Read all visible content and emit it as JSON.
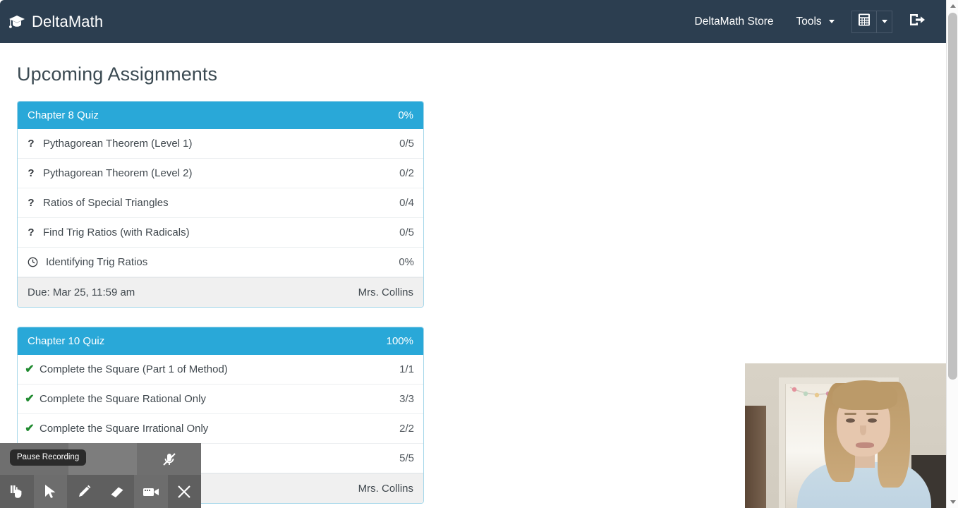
{
  "navbar": {
    "brand": "DeltaMath",
    "brand_icon": "graduation-cap-icon",
    "store_link": "DeltaMath Store",
    "tools_link": "Tools",
    "calculator_icon": "calculator-icon",
    "calculator_caret_icon": "chevron-down-icon",
    "logout_icon": "sign-out-icon",
    "background_color": "#2c3e50"
  },
  "page": {
    "title": "Upcoming Assignments",
    "accent_color": "#29a8d8",
    "card_border_color": "#a8d8ea",
    "check_color": "#1f8a2f"
  },
  "assignments": [
    {
      "title": "Chapter 8 Quiz",
      "percent": "0%",
      "rows": [
        {
          "icon": "question-mark-icon",
          "label": "Pythagorean Theorem (Level 1)",
          "score": "0/5"
        },
        {
          "icon": "question-mark-icon",
          "label": "Pythagorean Theorem (Level 2)",
          "score": "0/2"
        },
        {
          "icon": "question-mark-icon",
          "label": "Ratios of Special Triangles",
          "score": "0/4"
        },
        {
          "icon": "question-mark-icon",
          "label": "Find Trig Ratios (with Radicals)",
          "score": "0/5"
        },
        {
          "icon": "clock-icon",
          "label": "Identifying Trig Ratios",
          "score": "0%"
        }
      ],
      "due": "Due: Mar 25, 11:59 am",
      "teacher": "Mrs. Collins"
    },
    {
      "title": "Chapter 10 Quiz",
      "percent": "100%",
      "rows": [
        {
          "icon": "check-icon",
          "label": "Complete the Square (Part 1 of Method)",
          "score": "1/1"
        },
        {
          "icon": "check-icon",
          "label": "Complete the Square Rational Only",
          "score": "3/3"
        },
        {
          "icon": "check-icon",
          "label": "Complete the Square Irrational Only",
          "score": "2/2"
        },
        {
          "icon": "check-icon",
          "label": "",
          "score": "5/5"
        }
      ],
      "due": "",
      "teacher": "Mrs. Collins"
    }
  ],
  "recording_toolbar": {
    "tooltip": "Pause Recording",
    "buttons": [
      {
        "icon": "pause-hand-icon",
        "name": "pause-recording-button"
      },
      {
        "icon": "cursor-arrow-icon",
        "name": "select-tool-button"
      },
      {
        "icon": "pencil-icon",
        "name": "pen-tool-button"
      },
      {
        "icon": "eraser-icon",
        "name": "eraser-tool-button"
      },
      {
        "icon": "camcorder-icon",
        "name": "record-button"
      },
      {
        "icon": "close-x-icon",
        "name": "close-toolbar-button"
      }
    ]
  },
  "webcam": {
    "label": "webcam-video-overlay"
  },
  "scrollbar": {
    "up_icon": "scroll-up-arrow-icon",
    "down_icon": "scroll-down-arrow-icon"
  }
}
